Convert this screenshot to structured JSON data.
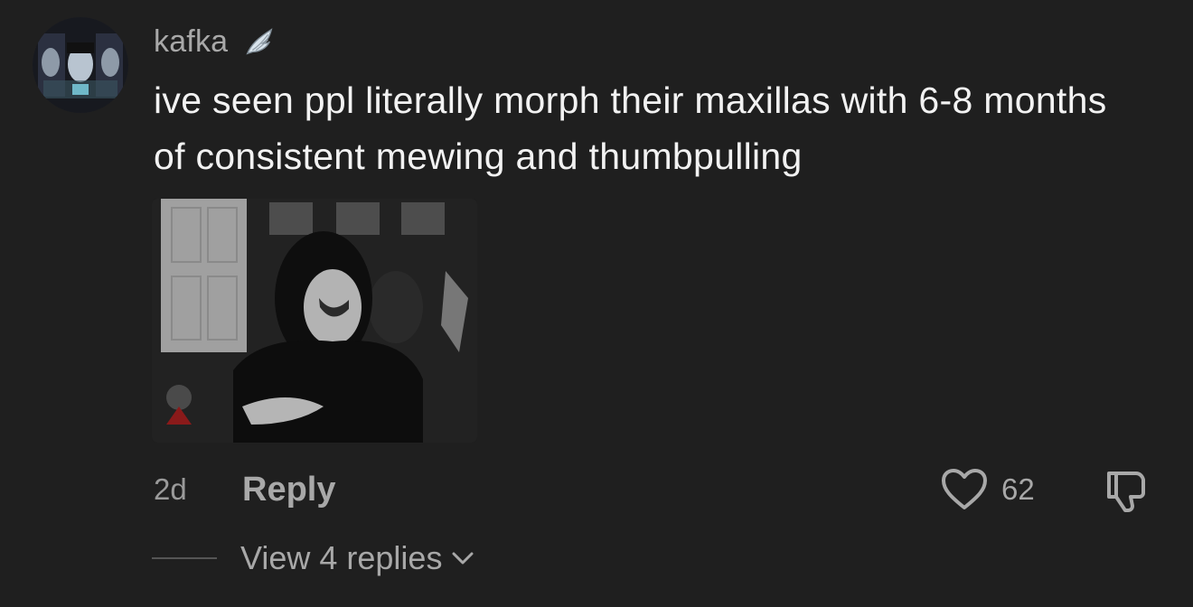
{
  "comment": {
    "username": "kafka",
    "badge_icon": "wing-icon",
    "text": "ive seen ppl literally morph their maxillas with 6-8 months of consistent mewing and thumbpulling",
    "timestamp": "2d",
    "reply_label": "Reply",
    "like_count": "62",
    "view_replies_label": "View 4 replies",
    "icons": {
      "like": "heart-outline-icon",
      "dislike": "thumbs-down-icon",
      "expand": "chevron-down-icon"
    }
  },
  "colors": {
    "background": "#1f1f1f",
    "text_primary": "#f2f2f2",
    "text_secondary": "#a8a8a8"
  }
}
